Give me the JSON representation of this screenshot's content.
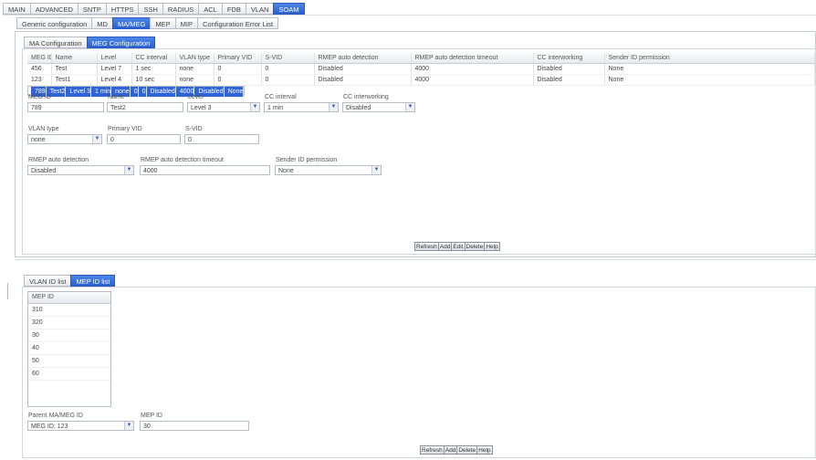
{
  "top_tabs": [
    "MAIN",
    "ADVANCED",
    "SNTP",
    "HTTPS",
    "SSH",
    "RADIUS",
    "ACL",
    "FDB",
    "VLAN",
    "SOAM"
  ],
  "top_tabs_active": 9,
  "sub_tabs": [
    "Generic configuration",
    "MD",
    "MA/MEG",
    "MEP",
    "MIP",
    "Configuration Error List"
  ],
  "sub_tabs_active": 2,
  "inner_tabs": [
    "MA Configuration",
    "MEG Configuration"
  ],
  "inner_tabs_active": 1,
  "meg_table": {
    "columns": [
      "MEG ID",
      "Name",
      "Level",
      "CC interval",
      "VLAN type",
      "Primary VID",
      "S-VID",
      "RMEP auto detection",
      "RMEP auto detection timeout",
      "CC interworking",
      "Sender ID permission"
    ],
    "rows": [
      [
        "456",
        "Test",
        "Level 7",
        "1 sec",
        "none",
        "0",
        "0",
        "Disabled",
        "4000",
        "Disabled",
        "None"
      ],
      [
        "123",
        "Test1",
        "Level 4",
        "10 sec",
        "none",
        "0",
        "0",
        "Disabled",
        "4000",
        "Disabled",
        "None"
      ],
      [
        "789",
        "Test2",
        "Level 3",
        "1 min",
        "none",
        "0",
        "0",
        "Disabled",
        "4000",
        "Disabled",
        "None"
      ]
    ],
    "selected_row": 2
  },
  "meg_form": {
    "meg_id_label": "MEG ID",
    "meg_id_value": "789",
    "name_label": "Name",
    "name_value": "Test2",
    "level_label": "Level",
    "level_value": "Level 3",
    "cc_interval_label": "CC interval",
    "cc_interval_value": "1 min",
    "cc_interworking_label": "CC interworking",
    "cc_interworking_value": "Disabled",
    "vlan_type_label": "VLAN type",
    "vlan_type_value": "none",
    "primary_vid_label": "Primary VID",
    "primary_vid_value": "0",
    "svid_label": "S-VID",
    "svid_value": "0",
    "rmep_label": "RMEP auto detection",
    "rmep_value": "Disabled",
    "rmep_timeout_label": "RMEP auto detection timeout",
    "rmep_timeout_value": "4000",
    "sender_label": "Sender ID permission",
    "sender_value": "None"
  },
  "meg_buttons": [
    "Refresh",
    "Add",
    "Edit",
    "Delete",
    "Help"
  ],
  "bottom_tabs": [
    "VLAN ID list",
    "MEP ID list"
  ],
  "bottom_tabs_active": 1,
  "mep_list": {
    "header": "MEP ID",
    "items": [
      "310",
      "320",
      "30",
      "40",
      "50",
      "60"
    ]
  },
  "mep_form": {
    "parent_label": "Parent MA/MEG ID",
    "parent_value": "MEG ID: 123",
    "mep_id_label": "MEP ID",
    "mep_id_value": "30"
  },
  "mep_buttons": [
    "Refresh",
    "Add",
    "Delete",
    "Help"
  ]
}
